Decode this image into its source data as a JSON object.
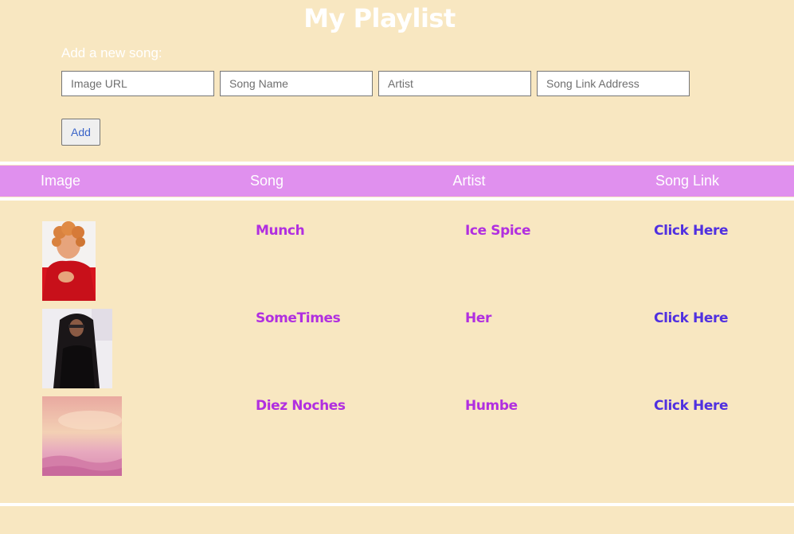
{
  "app": {
    "title": "My Playlist"
  },
  "form": {
    "label": "Add a new song:",
    "fields": {
      "image_url": {
        "placeholder": "Image URL",
        "value": ""
      },
      "song_name": {
        "placeholder": "Song Name",
        "value": ""
      },
      "artist": {
        "placeholder": "Artist",
        "value": ""
      },
      "song_link": {
        "placeholder": "Song Link Address",
        "value": ""
      }
    },
    "add_label": "Add"
  },
  "table": {
    "headers": [
      "Image",
      "Song",
      "Artist",
      "Song Link"
    ],
    "rows": [
      {
        "song": "Munch",
        "artist": "Ice Spice",
        "link_text": "Click Here"
      },
      {
        "song": "SomeTimes",
        "artist": "Her",
        "link_text": "Click Here"
      },
      {
        "song": "Diez Noches",
        "artist": "Humbe",
        "link_text": "Click Here"
      }
    ]
  },
  "colors": {
    "background": "#f8e7c1",
    "header_bar": "#e090ee",
    "song_text": "#b12fe0",
    "link_text": "#5030e0"
  }
}
